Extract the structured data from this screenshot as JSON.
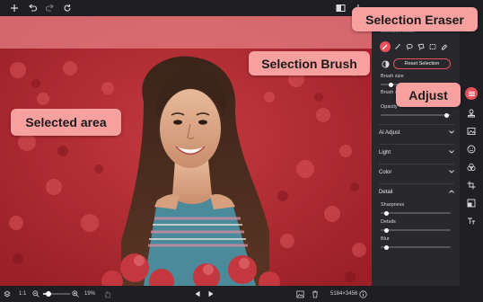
{
  "toolbar": {
    "icons": [
      "plus-icon",
      "undo-icon",
      "redo-icon",
      "refresh-icon",
      "compare-icon",
      "download-icon"
    ]
  },
  "panel": {
    "section_title": "Selection Mode",
    "reset_label": "Reset Selection",
    "brush_size_label": "Brush size",
    "brush_softness_label": "Brush softness",
    "opacity_label": "Opacity",
    "ai_adjust": "AI Adjust",
    "light": "Light",
    "color": "Color",
    "detail": "Detail",
    "sharpness": "Sharpness",
    "details": "Details",
    "blur": "Blur",
    "values": {
      "brush_size": 0.12,
      "opacity": 0.97,
      "sharpness": 0.05,
      "details": 0.05,
      "blur": 0.05
    }
  },
  "bottom": {
    "ratio": "1:1",
    "zoom": "19%",
    "dimensions": "5184×3456"
  },
  "callouts": {
    "selection_eraser": "Selection Eraser",
    "selection_brush": "Selection Brush",
    "adjust": "Adjust",
    "selected_area": "Selected area"
  },
  "colors": {
    "accent": "#e8505b",
    "callout": "#f6a1a0",
    "selection": "#b12a31"
  }
}
